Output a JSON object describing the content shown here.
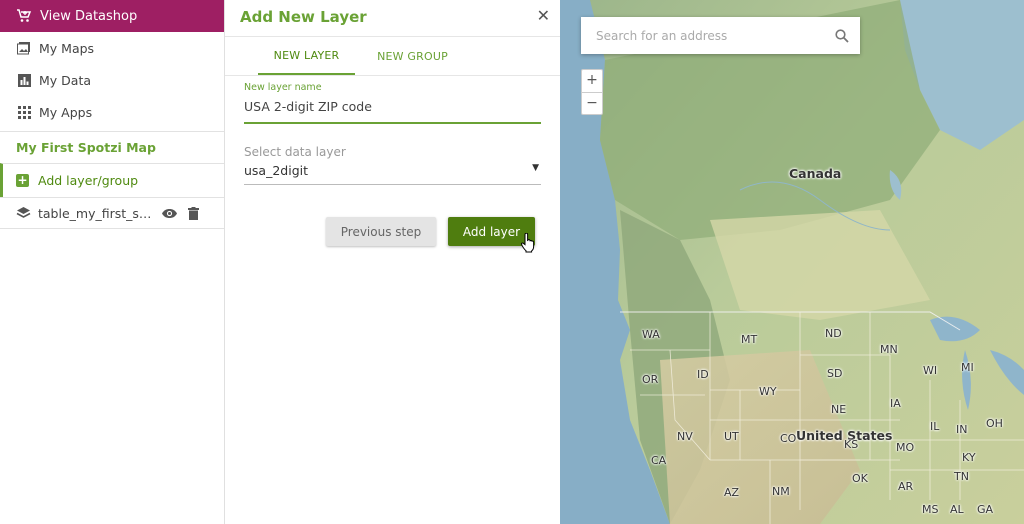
{
  "sidebar": {
    "datashop_label": "View Datashop",
    "nav": [
      {
        "label": "My Maps",
        "icon": "image-icon"
      },
      {
        "label": "My Data",
        "icon": "bar-chart-icon"
      },
      {
        "label": "My Apps",
        "icon": "grid-icon"
      }
    ],
    "map_title": "My First Spotzi Map",
    "add_layer_label": "Add layer/group",
    "layer_name": "table_my_first_spotzi_map"
  },
  "panel": {
    "title": "Add New Layer",
    "tabs": [
      "NEW LAYER",
      "NEW GROUP"
    ],
    "layer_name_label": "New layer name",
    "layer_name_value": "USA 2-digit ZIP code",
    "data_layer_label": "Select data layer",
    "data_layer_value": "usa_2digit",
    "prev_label": "Previous step",
    "add_label": "Add layer"
  },
  "map": {
    "search_placeholder": "Search for an address",
    "zoom_in": "+",
    "zoom_out": "−",
    "labels": {
      "canada": "Canada",
      "us": "United States",
      "WA": "WA",
      "MT": "MT",
      "ND": "ND",
      "MN": "MN",
      "OR": "OR",
      "ID": "ID",
      "SD": "SD",
      "WI": "WI",
      "MI": "MI",
      "WY": "WY",
      "NE": "NE",
      "IA": "IA",
      "NV": "NV",
      "UT": "UT",
      "CO": "CO",
      "IL": "IL",
      "IN": "IN",
      "OH": "OH",
      "CA": "CA",
      "KS": "KS",
      "MO": "MO",
      "KY": "KY",
      "OK": "OK",
      "AZ": "AZ",
      "NM": "NM",
      "AR": "AR",
      "TN": "TN",
      "MS": "MS",
      "AL": "AL",
      "GA": "GA"
    }
  },
  "colors": {
    "brand": "#9e1f63",
    "accent": "#6aa235",
    "button": "#4f7d0f"
  }
}
